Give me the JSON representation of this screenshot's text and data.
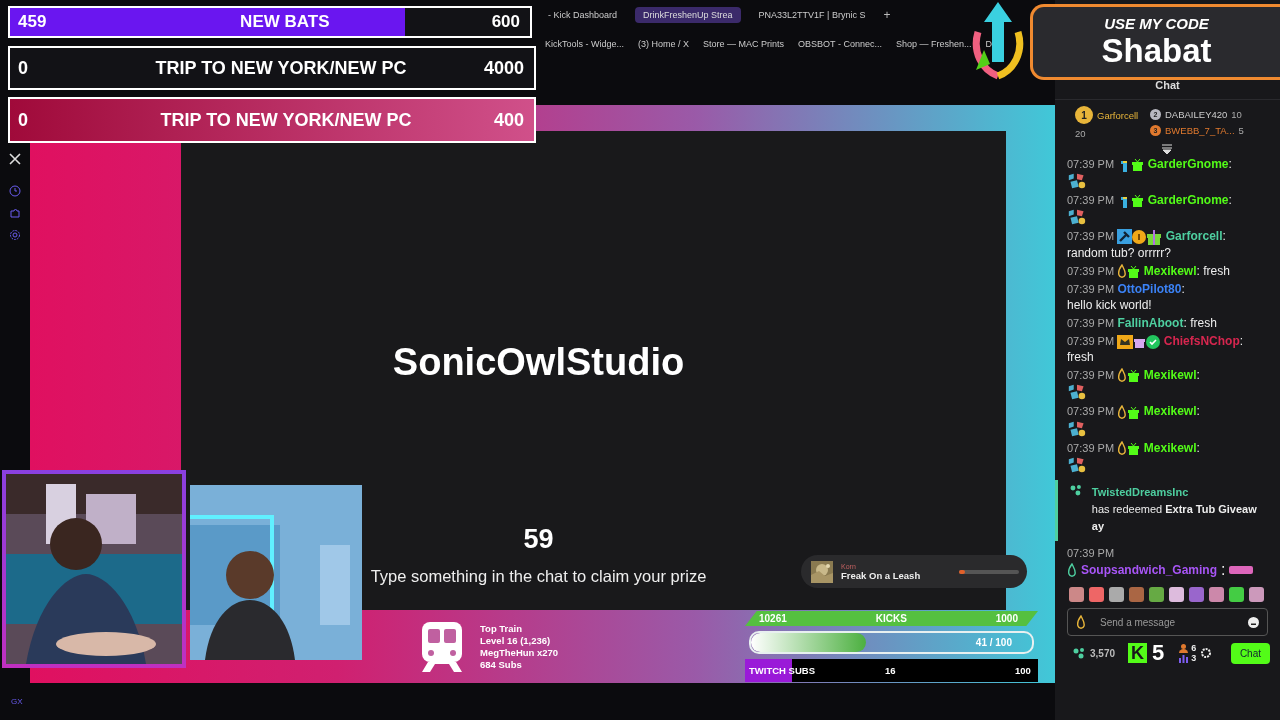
{
  "browser": {
    "tabs": [
      {
        "label": "- Kick Dashboard",
        "selected": false
      },
      {
        "label": "DrinkFreshenUp Strea",
        "selected": true
      },
      {
        "label": "PNA33L2TTV1F | Brynic S",
        "selected": false
      }
    ],
    "new_tab": "+",
    "bookmarks": [
      "KickTools - Widge...",
      "(3) Home / X",
      "Store — MAC Prints",
      "OBSBOT - Connec...",
      "Shop — Freshen...",
      "D"
    ]
  },
  "goals": [
    {
      "value": "459",
      "title": "NEW BATS",
      "target": "600",
      "level": 0.76
    },
    {
      "value": "0",
      "title": "TRIP TO NEW YORK/NEW PC",
      "target": "4000"
    },
    {
      "value": "0",
      "title": "TRIP TO NEW YORK/NEW PC",
      "target": "400"
    }
  ],
  "promo": {
    "heading": "USE MY CODE",
    "code": "Shabat"
  },
  "stream": {
    "title": "SonicOwlStudio",
    "countdown": "59",
    "prompt": "Type something in the chat to claim your prize",
    "now_playing": {
      "artist": "Korn",
      "track": "Freak On a Leash",
      "level": 0.1
    },
    "top_train": [
      "Top Train",
      "Level 16  (1,236)",
      "MegTheHun x270",
      "684 Subs"
    ],
    "kicks": {
      "current": "10261",
      "label": "KICKS",
      "target": "1000"
    },
    "subs": {
      "reading": "41 / 100",
      "level": 0.41
    },
    "twitch_subs": {
      "label": "TWITCH SUBS",
      "value": "16",
      "target": "100",
      "level": 0.16
    }
  },
  "bottom_label": "GX",
  "chat": {
    "title": "Chat",
    "leaders": [
      {
        "rank": "1",
        "name": "Garforcell",
        "count": "20",
        "color": "#e8b53a"
      },
      {
        "rank": "2",
        "name": "DABAILEY420",
        "count": "10",
        "color": "#b8b8c0"
      },
      {
        "rank": "3",
        "name": "BWEBB_7_TA...",
        "count": "5",
        "color": "#e0792e"
      }
    ],
    "messages": [
      {
        "time": "07:39 PM",
        "badges": [
          {
            "kind": "tier"
          },
          {
            "kind": "gift"
          }
        ],
        "name": "GarderGnome",
        "color": "#53fc18",
        "kind": "emote",
        "sep": ":"
      },
      {
        "time": "07:39 PM",
        "badges": [
          {
            "kind": "tier"
          },
          {
            "kind": "gift"
          }
        ],
        "name": "GarderGnome",
        "color": "#53fc18",
        "kind": "emote",
        "sep": ":"
      },
      {
        "time": "07:39 PM",
        "badges": [
          {
            "kind": "moderator"
          },
          {
            "kind": "rank"
          },
          {
            "kind": "gift-big"
          }
        ],
        "name": "Garforcell",
        "color": "#4ecfa0",
        "kind": "text",
        "sep": ":",
        "text": "random tub? orrrrr?"
      },
      {
        "time": "07:39 PM",
        "badges": [
          {
            "kind": "og"
          },
          {
            "kind": "gift"
          }
        ],
        "name": "Mexikewl",
        "color": "#53fc18",
        "kind": "text",
        "sep": ":",
        "text": "fresh"
      },
      {
        "time": "07:39 PM",
        "name": "OttoPilot80",
        "color": "#3b82f6",
        "kind": "text",
        "sep": ":",
        "text": "hello kick world!"
      },
      {
        "time": "07:39 PM",
        "name": "FallinAboot",
        "color": "#4ecfa0",
        "kind": "text",
        "sep": ":",
        "text": "fresh"
      },
      {
        "time": "07:39 PM",
        "badges": [
          {
            "kind": "crown"
          },
          {
            "kind": "gift-purple"
          },
          {
            "kind": "verified"
          }
        ],
        "name": "ChiefsNChop",
        "color": "#d7264f",
        "kind": "text",
        "sep": ":",
        "text": "fresh"
      },
      {
        "time": "07:39 PM",
        "badges": [
          {
            "kind": "og"
          },
          {
            "kind": "gift"
          }
        ],
        "name": "Mexikewl",
        "color": "#53fc18",
        "kind": "emote",
        "sep": ":"
      },
      {
        "time": "07:39 PM",
        "badges": [
          {
            "kind": "og"
          },
          {
            "kind": "gift"
          }
        ],
        "name": "Mexikewl",
        "color": "#53fc18",
        "kind": "emote",
        "sep": ":"
      },
      {
        "time": "07:39 PM",
        "badges": [
          {
            "kind": "og"
          },
          {
            "kind": "gift"
          }
        ],
        "name": "Mexikewl",
        "color": "#53fc18",
        "kind": "emote",
        "sep": ":"
      }
    ],
    "redeem": {
      "user": "TwistedDreamsInc",
      "text": "has redeemed **Extra Tub Giveaw ay**"
    },
    "last": {
      "time": "07:39 PM",
      "name": "Soupsandwich_Gaming",
      "color": "#a855f7",
      "text": ":"
    },
    "placeholder": "Send a message",
    "points": "3,570",
    "logo": "K",
    "viewers": "5",
    "stat_a": "6",
    "stat_b": "3",
    "send": "Chat"
  }
}
